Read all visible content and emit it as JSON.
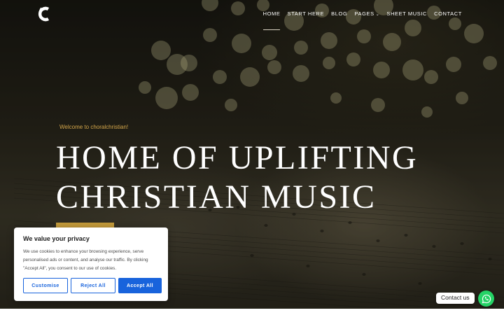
{
  "nav": {
    "items": [
      {
        "label": "HOME",
        "active": true
      },
      {
        "label": "START HERE"
      },
      {
        "label": "BLOG"
      },
      {
        "label": "PAGES",
        "has_dropdown": true
      },
      {
        "label": "SHEET MUSIC"
      },
      {
        "label": "CONTACT"
      }
    ]
  },
  "hero": {
    "eyebrow": "Welcome to choralchristian!",
    "headline_line1": "HOME OF UPLIFTING",
    "headline_line2": "CHRISTIAN MUSIC"
  },
  "cookie_banner": {
    "title": "We value your privacy",
    "text": "We use cookies to enhance your browsing experience, serve personalised ads or content, and analyse our traffic. By clicking \"Accept All\", you consent to our use of cookies.",
    "customise_label": "Customise",
    "reject_label": "Reject All",
    "accept_label": "Accept All"
  },
  "contact_widget": {
    "label": "Contact us",
    "icon": "whatsapp-icon"
  },
  "colors": {
    "accent_gold": "#d4a64a",
    "cta_gold": "#c39a3a",
    "cookie_blue": "#1863dc",
    "whatsapp_green": "#25d366"
  }
}
